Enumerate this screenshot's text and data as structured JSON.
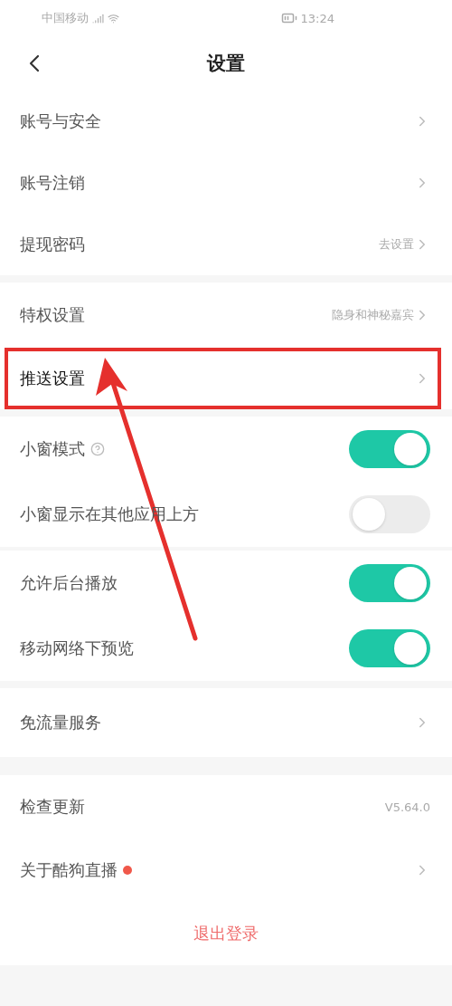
{
  "status_bar": {
    "carrier": "中国移动",
    "time": "13:24"
  },
  "header": {
    "title": "设置"
  },
  "sections": [
    {
      "rows": [
        {
          "kind": "link",
          "label": "账号与安全",
          "highlighted": false
        },
        {
          "kind": "link",
          "label": "账号注销",
          "highlighted": false
        },
        {
          "kind": "link",
          "label": "提现密码",
          "value": "去设置",
          "highlighted": false
        }
      ]
    },
    {
      "rows": [
        {
          "kind": "link",
          "label": "特权设置",
          "value": "隐身和神秘嘉宾",
          "highlighted": false
        },
        {
          "kind": "link",
          "label": "推送设置",
          "highlighted": true
        }
      ]
    },
    {
      "rows": [
        {
          "kind": "toggle",
          "label": "小窗模式",
          "help": true,
          "on": true
        },
        {
          "kind": "toggle",
          "label": "小窗显示在其他应用上方",
          "on": false
        }
      ]
    },
    {
      "rows": [
        {
          "kind": "toggle",
          "label": "允许后台播放",
          "on": true
        },
        {
          "kind": "toggle",
          "label": "移动网络下预览",
          "on": true
        }
      ]
    },
    {
      "rows": [
        {
          "kind": "link",
          "label": "免流量服务",
          "highlighted": false
        }
      ]
    },
    {
      "rows": [
        {
          "kind": "info",
          "label": "检查更新",
          "value": "V5.64.0"
        },
        {
          "kind": "link",
          "label": "关于酷狗直播",
          "dot": {
            "color": "#f0584a"
          },
          "highlighted": false
        }
      ]
    }
  ],
  "logout": {
    "label": "退出登录"
  }
}
